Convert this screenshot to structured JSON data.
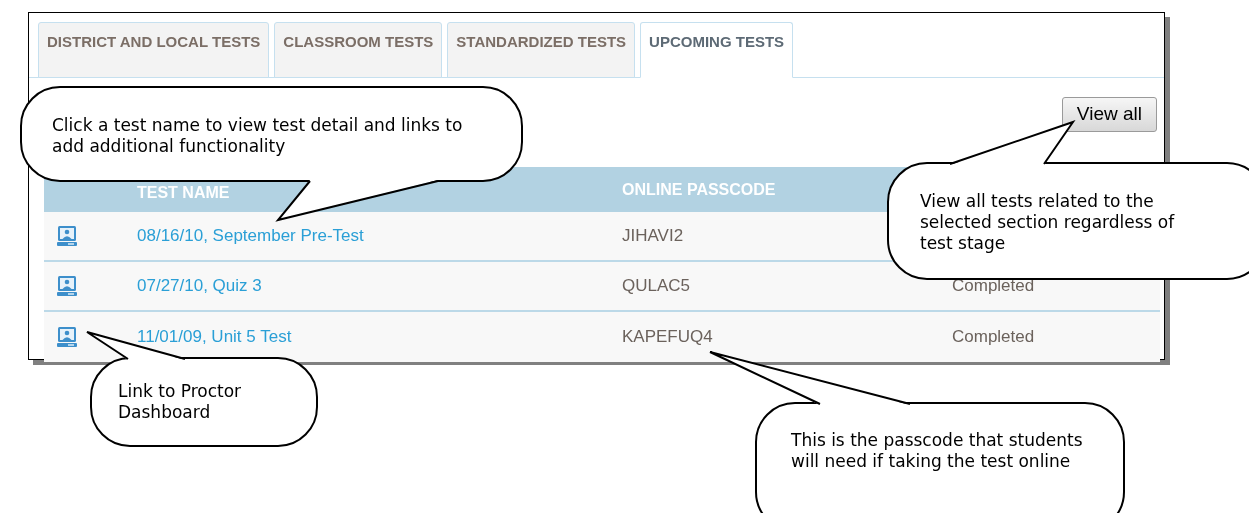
{
  "tabs": [
    {
      "label": "DISTRICT AND LOCAL TESTS",
      "selected": false
    },
    {
      "label": "CLASSROOM TESTS",
      "selected": false
    },
    {
      "label": "STANDARDIZED TESTS",
      "selected": false
    },
    {
      "label": "UPCOMING TESTS",
      "selected": true
    }
  ],
  "view_all_button": "View all",
  "table": {
    "columns": [
      "TEST NAME",
      "ONLINE PASSCODE"
    ],
    "rows": [
      {
        "test_name": "08/16/10, September Pre-Test",
        "passcode": "JIHAVI2"
      },
      {
        "test_name": "07/27/10, Quiz 3",
        "passcode": "QULAC5",
        "status": "Completed"
      },
      {
        "test_name": "11/01/09, Unit 5 Test",
        "passcode": "KAPEFUQ4",
        "status": "Completed"
      }
    ]
  },
  "callouts": [
    "Click a test name to view test detail and links to add additional functionality",
    "View all tests related to the selected section regardless of test stage",
    "Link to Proctor Dashboard",
    "This is the passcode that students will need if taking the test online"
  ]
}
